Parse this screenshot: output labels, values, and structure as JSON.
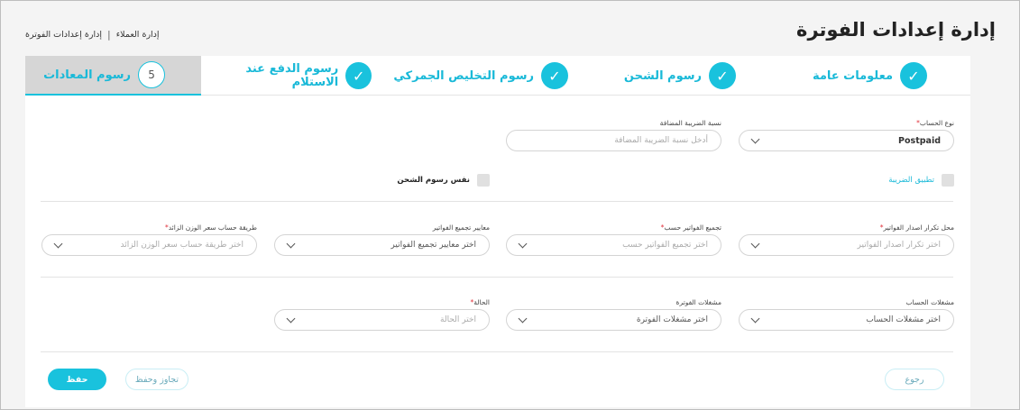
{
  "header": {
    "title": "إدارة إعدادات الفوترة",
    "breadcrumb": [
      "إدارة العملاء",
      "إدارة إعدادات الفوترة"
    ],
    "separator": "|"
  },
  "steps": [
    {
      "label": "معلومات عامة",
      "state": "done",
      "icon": "check-icon"
    },
    {
      "label": "رسوم الشحن",
      "state": "done",
      "icon": "check-icon"
    },
    {
      "label": "رسوم التخليص الجمركي",
      "state": "done",
      "icon": "check-icon"
    },
    {
      "label": "رسوم الدفع عند الاستلام",
      "state": "done",
      "icon": "check-icon"
    },
    {
      "label": "رسوم المعادات",
      "state": "active",
      "number": "5"
    }
  ],
  "fields": {
    "account_type": {
      "label": "نوع الحساب",
      "value": "Postpaid"
    },
    "vat_rate": {
      "label": "نسبة الضريبة المضافة",
      "placeholder": "أدخل نسبة الضريبة المضافة"
    },
    "apply_tax": {
      "label": "تطبيق الضريبة"
    },
    "same_shipping": {
      "label": "نفس رسوم الشحن"
    },
    "invoice_frequency": {
      "label": "محل تكرار اصدار الفواتير",
      "placeholder": "اختر تكرار اصدار الفواتير"
    },
    "group_by": {
      "label": "تجميع الفواتير حسب",
      "placeholder": "اختر تجميع الفواتير حسب"
    },
    "group_criteria": {
      "label": "معايير تجميع الفواتير",
      "value": "اختر معايير تجميع الفواتير"
    },
    "extra_weight_method": {
      "label": "طريقة حساب سعر الوزن الزائد",
      "placeholder": "اختر طريقة حساب سعر الوزن الزائد"
    },
    "account_triggers": {
      "label": "مشغلات الحساب",
      "value": "اختر مشغلات الحساب"
    },
    "invoice_triggers": {
      "label": "مشغلات الفوترة",
      "value": "اختر مشغلات الفوترة"
    },
    "status": {
      "label": "الحالة",
      "placeholder": "اختر الحالة"
    }
  },
  "required_mark": "*",
  "buttons": {
    "save": "حفظ",
    "skip_save": "تجاوز وحفظ",
    "back": "رجوع"
  },
  "colors": {
    "accent": "#19c2dd",
    "required": "#e0303a",
    "active_tab_bg": "#d6d6d6"
  }
}
